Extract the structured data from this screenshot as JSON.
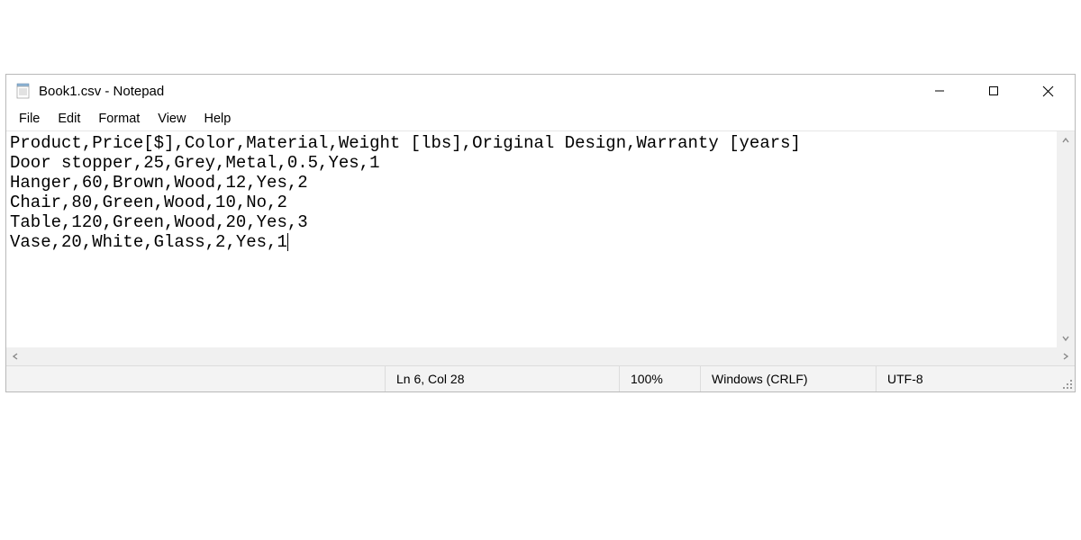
{
  "window": {
    "title": "Book1.csv - Notepad"
  },
  "menu": {
    "file": "File",
    "edit": "Edit",
    "format": "Format",
    "view": "View",
    "help": "Help"
  },
  "content": {
    "lines": [
      "Product,Price[$],Color,Material,Weight [lbs],Original Design,Warranty [years]",
      "Door stopper,25,Grey,Metal,0.5,Yes,1",
      "Hanger,60,Brown,Wood,12,Yes,2",
      "Chair,80,Green,Wood,10,No,2",
      "Table,120,Green,Wood,20,Yes,3",
      "Vase,20,White,Glass,2,Yes,1"
    ]
  },
  "status": {
    "position": "Ln 6, Col 28",
    "zoom": "100%",
    "eol": "Windows (CRLF)",
    "encoding": "UTF-8"
  }
}
